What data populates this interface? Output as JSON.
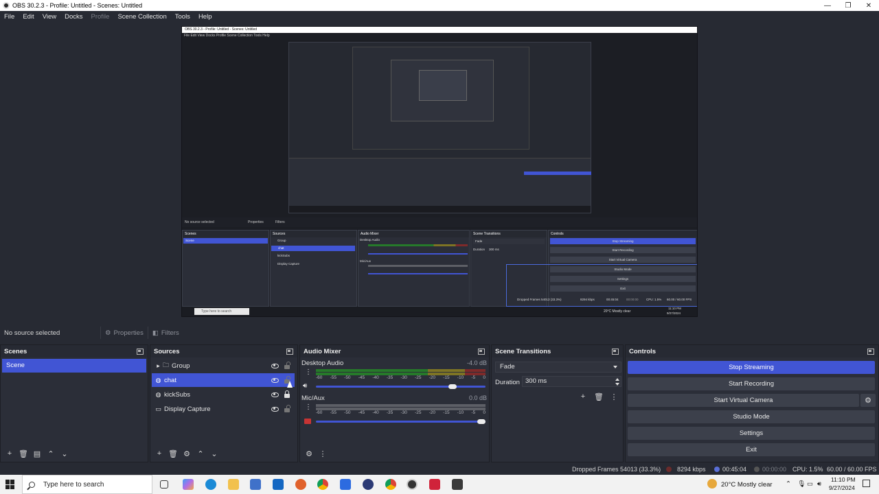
{
  "window": {
    "title": "OBS 30.2.3 - Profile: Untitled - Scenes: Untitled",
    "min": "—",
    "max": "❐",
    "close": "✕"
  },
  "menu": [
    "File",
    "Edit",
    "View",
    "Docks",
    "Profile",
    "Scene Collection",
    "Tools",
    "Help"
  ],
  "source_toolbar": {
    "no_source": "No source selected",
    "properties": "Properties",
    "filters": "Filters"
  },
  "scenes": {
    "title": "Scenes",
    "items": [
      "Scene"
    ]
  },
  "sources": {
    "title": "Sources",
    "items": [
      {
        "name": "Group",
        "type": "group"
      },
      {
        "name": "chat",
        "type": "browser"
      },
      {
        "name": "kickSubs",
        "type": "browser"
      },
      {
        "name": "Display Capture",
        "type": "display"
      }
    ]
  },
  "mixer": {
    "title": "Audio Mixer",
    "ticks": [
      "-60",
      "-55",
      "-50",
      "-45",
      "-40",
      "-35",
      "-30",
      "-25",
      "-20",
      "-15",
      "-10",
      "-5",
      "0"
    ],
    "channels": [
      {
        "name": "Desktop Audio",
        "db": "-4.0 dB",
        "volume": 0.83,
        "muted": false
      },
      {
        "name": "Mic/Aux",
        "db": "0.0 dB",
        "volume": 1.0,
        "muted": true
      }
    ]
  },
  "transitions": {
    "title": "Scene Transitions",
    "selected": "Fade",
    "duration_label": "Duration",
    "duration": "300 ms"
  },
  "controls": {
    "title": "Controls",
    "buttons": [
      "Stop Streaming",
      "Start Recording",
      "Start Virtual Camera",
      "Studio Mode",
      "Settings",
      "Exit"
    ]
  },
  "status": {
    "dropped": "Dropped Frames 54013 (33.3%)",
    "kbps": "8294 kbps",
    "stream_time": "00:45:04",
    "rec_time": "00:00:00",
    "cpu": "CPU: 1.5%",
    "fps": "60.00 / 60.00 FPS"
  },
  "taskbar": {
    "search_placeholder": "Type here to search",
    "weather": "20°C  Mostly clear",
    "time": "11:10 PM",
    "date": "9/27/2024"
  },
  "preview": {
    "title": "OBS 30.2.3 - Profile: Untitled - Scenes: Untitled",
    "menu": "File   Edit   View   Docks   Profile   Scene Collection   Tools   Help",
    "no_source": "No source selected",
    "properties": "Properties",
    "filters": "Filters",
    "scenes": "Scenes",
    "scene_item": "Scene",
    "sources": "Sources",
    "src_group": "Group",
    "src_chat": "chat",
    "src_kick": "kickSubs",
    "src_display": "Display Capture",
    "mixer": "Audio Mixer",
    "desktop_audio": "Desktop Audio",
    "mic": "Mic/Aux",
    "transitions": "Scene Transitions",
    "fade": "Fade",
    "duration": "Duration",
    "duration_val": "300 ms",
    "controls": "Controls",
    "stop_streaming": "Stop Streaming",
    "start_recording": "Start Recording",
    "start_vcam": "Start Virtual Camera",
    "studio_mode": "Studio Mode",
    "settings": "Settings",
    "exit": "Exit",
    "dropped": "Dropped Frames 54013 (33.3%)",
    "kbps": "8294 kbps",
    "stream_time": "00:45:04",
    "rec_time": "00:00:00",
    "cpu": "CPU: 1.5%",
    "fps": "60.00 / 60.00 FPS",
    "search": "Type here to search",
    "weather": "20°C  Mostly clear",
    "time": "11:10 PM",
    "date": "9/27/2024"
  },
  "colors": {
    "accent": "#4155d4",
    "panel": "#2b2e38",
    "bg": "#272a33"
  }
}
